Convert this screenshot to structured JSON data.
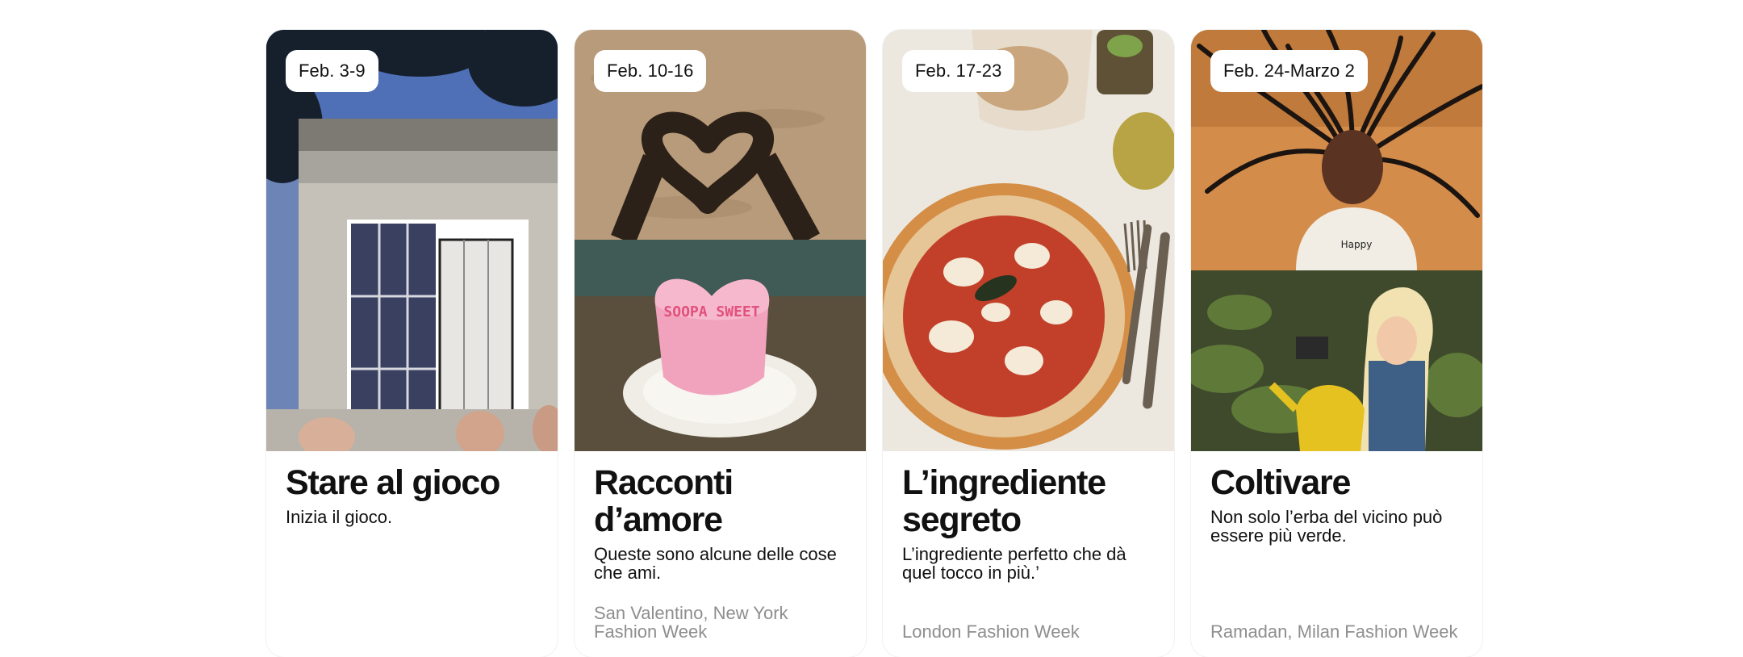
{
  "cards": [
    {
      "date": "Feb. 3-9",
      "title": "Stare al gioco",
      "description": "Inizia il gioco.",
      "tags": "",
      "image": "house-window-photo"
    },
    {
      "date": "Feb. 10-16",
      "title": "Racconti d’amore",
      "description": "Queste sono alcune delle cose che ami.",
      "tags": "San Valentino, New York Fashion Week",
      "image": "sand-heart-and-heart-cake-photo",
      "cake_text": "SOOPA SWEET"
    },
    {
      "date": "Feb. 17-23",
      "title": "L’ingrediente segreto",
      "description": "L’ingrediente perfetto che dà quel tocco in più.’",
      "tags": "London Fashion Week",
      "image": "pizza-photo"
    },
    {
      "date": "Feb. 24-Marzo 2",
      "title": "Coltivare",
      "description": "Non solo l’erba del vicino può essere più verde.",
      "tags": "Ramadan, Milan Fashion Week",
      "image": "hair-and-garden-photo",
      "shirt_text": "Happy"
    }
  ]
}
